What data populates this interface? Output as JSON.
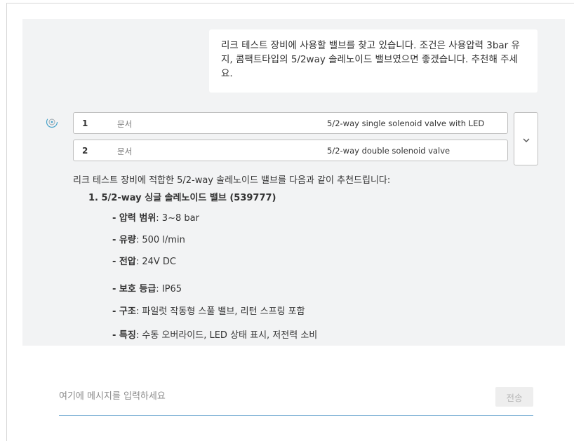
{
  "user_message": {
    "line1": "리크 테스트 장비에 사용할 밸브를 찾고 있습니다. 조건은 사용압력 3bar 유",
    "line2": "지, 콤팩트타입의 5/2way 솔레노이드 밸브였으면 좋겠습니다. 추천해 주세",
    "line3": "요."
  },
  "bot_avatar_icon": "assistant-spinner-icon",
  "sources": [
    {
      "number": "1",
      "type": "문서",
      "title": "5/2-way single solenoid valve with LED"
    },
    {
      "number": "2",
      "type": "문서",
      "title": "5/2-way double solenoid valve"
    }
  ],
  "expand_icon": "chevron-down-icon",
  "answer": {
    "intro": "리크 테스트 장비에 적합한 5/2-way 솔레노이드 밸브를 다음과 같이 추천드립니다:",
    "item_title": "1. 5/2-way 싱글 솔레노이드 밸브 (539777)",
    "specs": [
      {
        "label": "- 압력 범위",
        "value": ": 3~8 bar"
      },
      {
        "label": "- 유량",
        "value": ": 500 l/min"
      },
      {
        "label": "- 전압",
        "value": ": 24V DC"
      },
      {
        "label": "- 보호 등급",
        "value": ": IP65"
      },
      {
        "label": "- 구조",
        "value": ": 파일럿 작동형 스풀 밸브, 리턴 스프링 포함"
      },
      {
        "label": "- 특징",
        "value": ": 수동 오버라이드, LED 상태 표시, 저전력 소비"
      }
    ]
  },
  "composer": {
    "placeholder": "여기에 메시지를 입력하세요",
    "value": "",
    "send_label": "전송"
  },
  "colors": {
    "chat_background": "#f2f3f4",
    "bubble_background": "#ffffff",
    "input_underline": "#7fb2d6",
    "send_disabled_bg": "#eeeeee",
    "send_disabled_text": "#b5b5b5"
  }
}
